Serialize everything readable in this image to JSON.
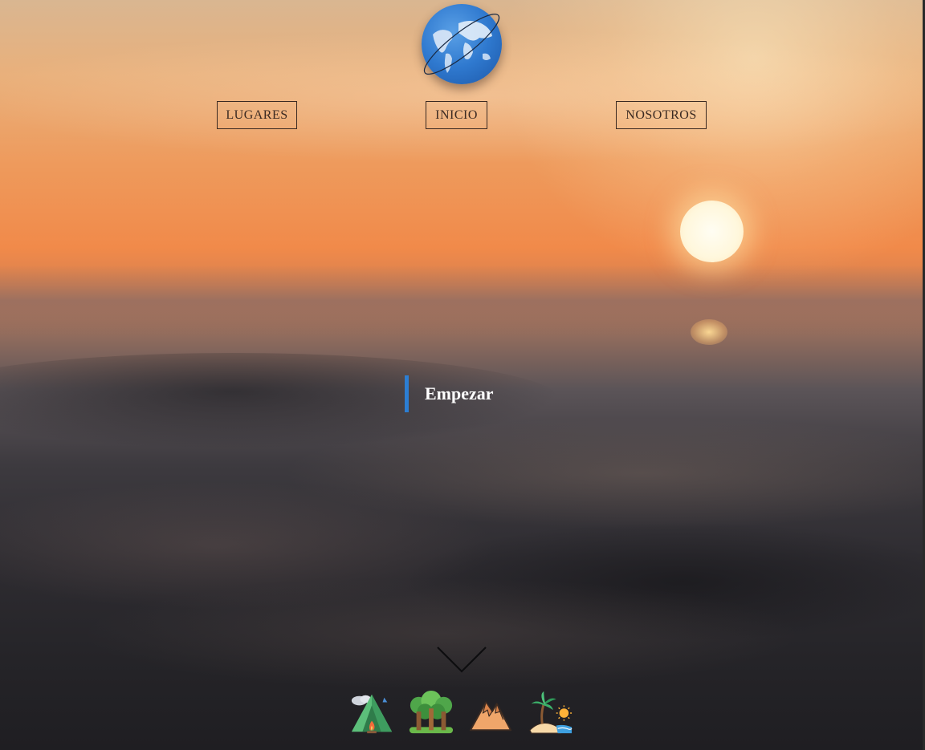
{
  "header": {
    "logo_icon": "globe-icon"
  },
  "nav": {
    "items": [
      {
        "label": "LUGARES"
      },
      {
        "label": "INICIO"
      },
      {
        "label": "NOSOTROS"
      }
    ]
  },
  "hero": {
    "start_label": "Empezar",
    "start_accent_color": "#2c7ed3",
    "scroll_icon": "chevron-down-icon"
  },
  "categories": [
    {
      "icon": "camping-tent-icon"
    },
    {
      "icon": "forest-icon"
    },
    {
      "icon": "mountain-icon"
    },
    {
      "icon": "beach-island-icon"
    }
  ]
}
